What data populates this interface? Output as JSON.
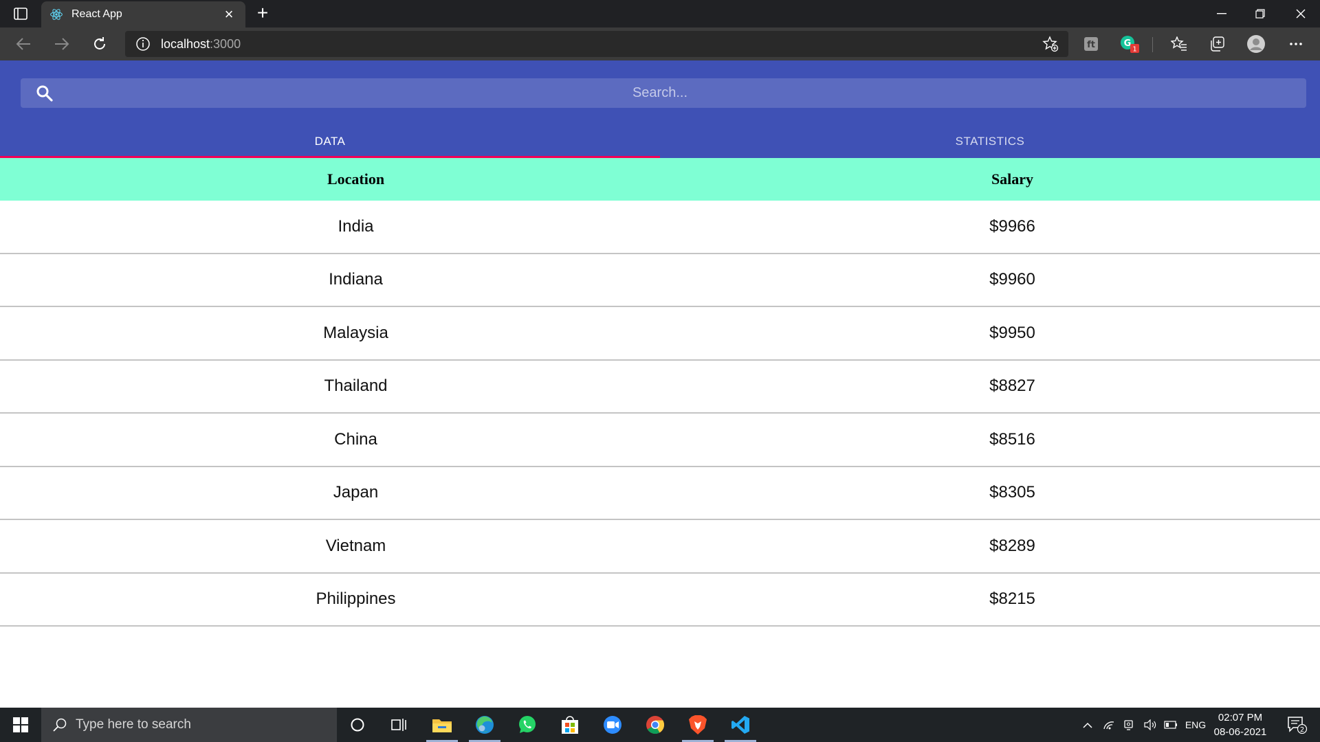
{
  "browser": {
    "tab_title": "React App",
    "url_host": "localhost",
    "url_port": ":3000",
    "notification_badge": "1"
  },
  "app": {
    "search_placeholder": "Search...",
    "tabs": [
      {
        "label": "DATA",
        "selected": true
      },
      {
        "label": "STATISTICS",
        "selected": false
      }
    ],
    "accent_color": "#3f51b5",
    "indicator_color": "#f50057",
    "header_row_color": "#7fffd4"
  },
  "table": {
    "columns": [
      "Location",
      "Salary"
    ],
    "rows": [
      {
        "location": "India",
        "salary": "$9966"
      },
      {
        "location": "Indiana",
        "salary": "$9960"
      },
      {
        "location": "Malaysia",
        "salary": "$9950"
      },
      {
        "location": "Thailand",
        "salary": "$8827"
      },
      {
        "location": "China",
        "salary": "$8516"
      },
      {
        "location": "Japan",
        "salary": "$8305"
      },
      {
        "location": "Vietnam",
        "salary": "$8289"
      },
      {
        "location": "Philippines",
        "salary": "$8215"
      }
    ]
  },
  "taskbar": {
    "search_placeholder": "Type here to search",
    "language": "ENG",
    "time": "02:07 PM",
    "date": "08-06-2021",
    "notification_count": "2"
  }
}
